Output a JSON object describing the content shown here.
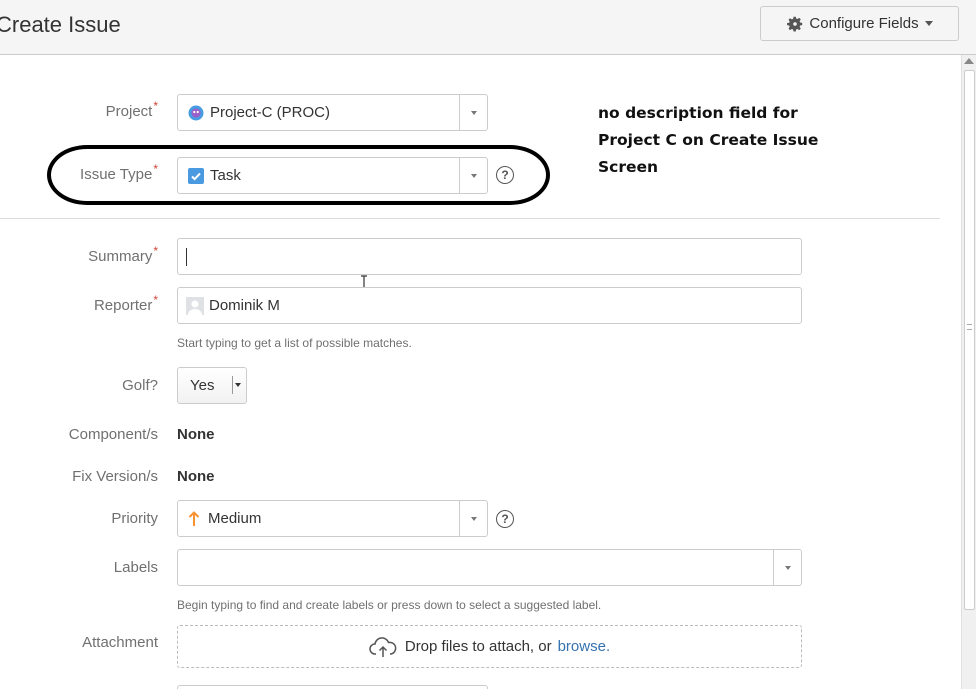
{
  "dialog": {
    "title": "Create Issue",
    "configure_fields": "Configure Fields"
  },
  "fields": {
    "project": {
      "label": "Project",
      "value": "Project-C (PROC)"
    },
    "issue_type": {
      "label": "Issue Type",
      "value": "Task"
    },
    "summary": {
      "label": "Summary",
      "value": ""
    },
    "reporter": {
      "label": "Reporter",
      "value": "Dominik M",
      "hint": "Start typing to get a list of possible matches."
    },
    "golf": {
      "label": "Golf?",
      "value": "Yes"
    },
    "components": {
      "label": "Component/s",
      "value": "None"
    },
    "fix_versions": {
      "label": "Fix Version/s",
      "value": "None"
    },
    "priority": {
      "label": "Priority",
      "value": "Medium"
    },
    "labels": {
      "label": "Labels",
      "value": "",
      "hint": "Begin typing to find and create labels or press down to select a suggested label."
    },
    "attachment": {
      "label": "Attachment",
      "drop_text": "Drop files to attach, or",
      "browse": "browse."
    }
  },
  "annotation": {
    "line1": "no description field for",
    "line2": "Project C on Create Issue",
    "line3": "Screen"
  },
  "colors": {
    "required": "#d04437",
    "link": "#3572b0",
    "priority_medium": "#f79232",
    "task_blue": "#4a9ae1"
  }
}
